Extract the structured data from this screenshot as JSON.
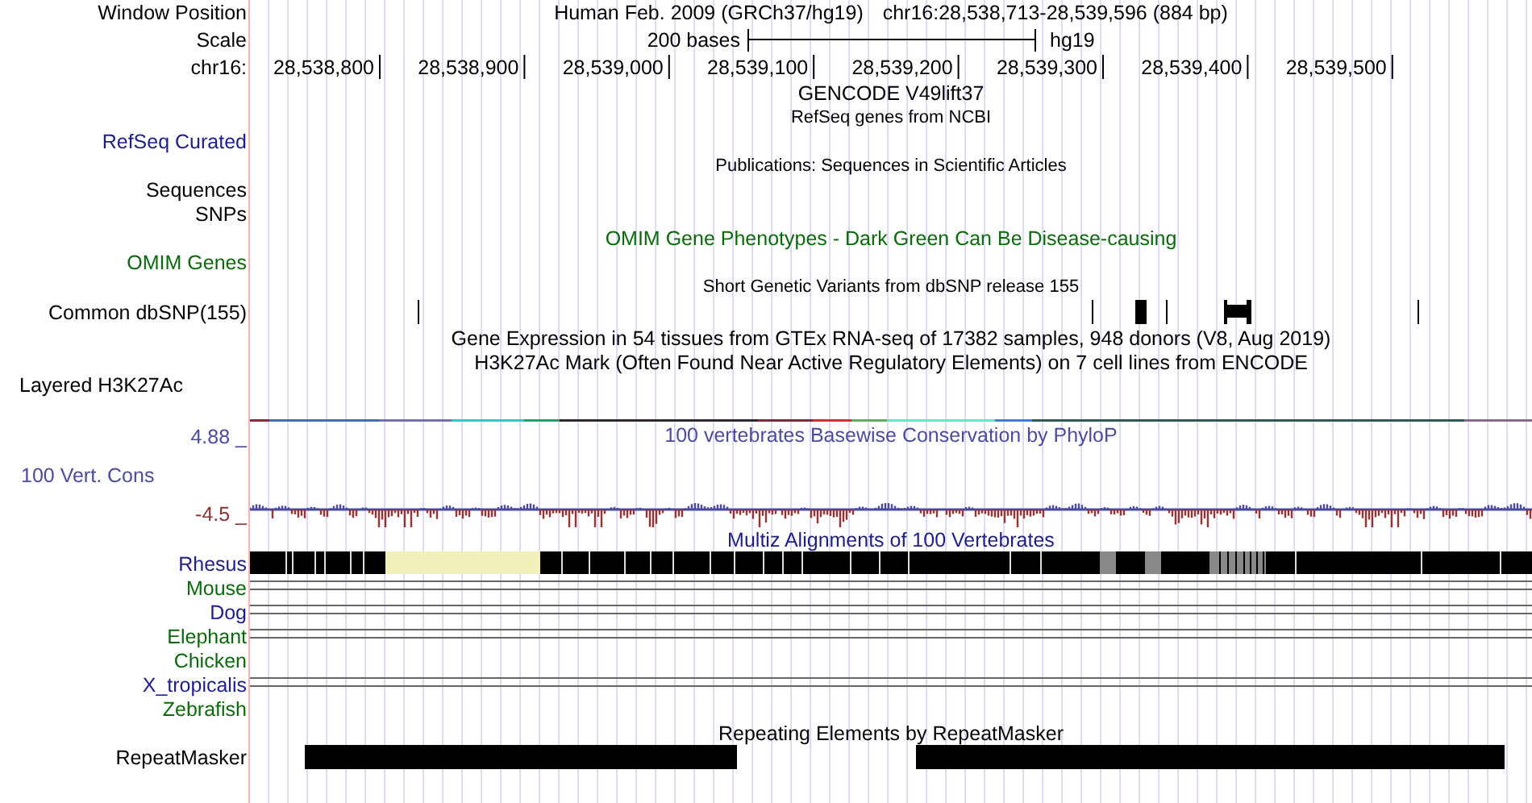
{
  "header": {
    "label": "Window Position",
    "assembly": "Human Feb. 2009 (GRCh37/hg19)",
    "position": "chr16:28,538,713-28,539,596 (884 bp)"
  },
  "scale": {
    "label": "Scale",
    "length": "200 bases",
    "assembly": "hg19"
  },
  "ruler": {
    "label": "chr16:",
    "ticks": [
      "28,538,800",
      "28,538,900",
      "28,539,000",
      "28,539,100",
      "28,539,200",
      "28,539,300",
      "28,539,400",
      "28,539,500"
    ]
  },
  "rows": [
    {
      "kind": "title",
      "text": "GENCODE V49lift37"
    },
    {
      "kind": "note",
      "text": "RefSeq genes from NCBI"
    },
    {
      "kind": "label",
      "label": "RefSeq Curated",
      "color": "#1d1d8c"
    },
    {
      "kind": "note",
      "text": "Publications: Sequences in Scientific Articles"
    },
    {
      "kind": "label",
      "label": "Sequences"
    },
    {
      "kind": "label",
      "label": "SNPs"
    },
    {
      "kind": "title",
      "text": "OMIM Gene Phenotypes - Dark Green Can Be Disease-causing",
      "color": "#0b6a0b"
    },
    {
      "kind": "label",
      "label": "OMIM Genes",
      "color": "#0b6a0b"
    },
    {
      "kind": "note",
      "text": "Short Genetic Variants from dbSNP release 155"
    },
    {
      "kind": "snps",
      "label": "Common dbSNP(155)"
    },
    {
      "kind": "title",
      "text": "Gene Expression in 54 tissues from GTEx RNA-seq of 17382 samples, 948 donors (V8, Aug 2019)"
    },
    {
      "kind": "title",
      "text": "H3K27Ac Mark (Often Found Near Active Regulatory Elements) on 7 cell lines from ENCODE"
    },
    {
      "kind": "composite",
      "label": "Layered H3K27Ac"
    },
    {
      "kind": "wiggle",
      "label": "100 Vert. Cons",
      "title": "100 vertebrates Basewise Conservation by PhyloP",
      "max_label": "4.88 _",
      "min_label": "-4.5 _",
      "color": "#4b4ba0"
    },
    {
      "kind": "title",
      "text": "Multiz Alignments of 100 Vertebrates",
      "color": "#1d1d8c"
    },
    {
      "kind": "blocks",
      "label": "Rhesus",
      "color": "#1d1d8c"
    },
    {
      "kind": "lines",
      "label": "Mouse",
      "color": "#0b6a0b"
    },
    {
      "kind": "lines",
      "label": "Dog",
      "color": "#1d1d8c"
    },
    {
      "kind": "lines",
      "label": "Elephant",
      "color": "#0b6a0b"
    },
    {
      "kind": "label",
      "label": "Chicken",
      "color": "#0b6a0b"
    },
    {
      "kind": "lines",
      "label": "X_tropicalis",
      "color": "#1d1d8c"
    },
    {
      "kind": "label",
      "label": "Zebrafish",
      "color": "#0b6a0b"
    },
    {
      "kind": "title",
      "text": "Repeating Elements by RepeatMasker"
    },
    {
      "kind": "repeats",
      "label": "RepeatMasker"
    }
  ]
}
